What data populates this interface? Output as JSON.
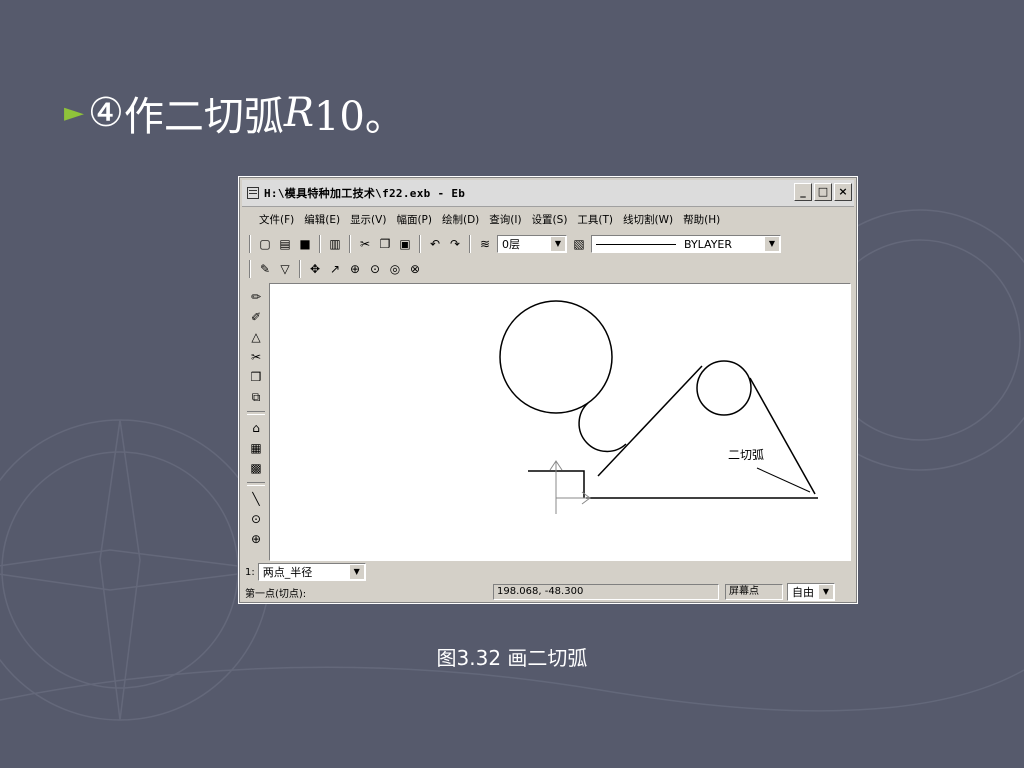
{
  "slide": {
    "bullet_symbol": "►",
    "step_number": "④",
    "heading_text": "作二切弧",
    "heading_italic": "R",
    "heading_tail": "10。",
    "caption": "图3.32  画二切弧"
  },
  "window": {
    "title": "H:\\模具特种加工技术\\f22.exb - Eb",
    "controls": [
      "_",
      "□",
      "×"
    ],
    "menu": [
      "文件(F)",
      "编辑(E)",
      "显示(V)",
      "幅面(P)",
      "绘制(D)",
      "查询(I)",
      "设置(S)",
      "工具(T)",
      "线切割(W)",
      "帮助(H)"
    ],
    "layer_value": "0层",
    "linetype_value": "BYLAYER",
    "drawing_label": "二切弧",
    "command_prefix": "1:",
    "command_mode": "两点_半径",
    "prompt": "第一点(切点):",
    "coordinates": "198.068, -48.300",
    "snap_label": "屏幕点",
    "snap_mode": "自由"
  },
  "icons": {
    "toolbar1": [
      "new-icon",
      "open-icon",
      "save-icon",
      "print-icon",
      "cut-icon",
      "copy-icon",
      "paste-icon",
      "undo-icon",
      "redo-icon",
      "layer-icon"
    ],
    "toolbar2": [
      "pencil-icon",
      "filter-icon",
      "pan-icon",
      "zoom-dynamic-icon",
      "zoom-in-icon",
      "zoom-window-icon",
      "zoom-all-icon",
      "zoom-prev-icon"
    ],
    "left": [
      "draw-icon",
      "edit-icon",
      "dimension-icon",
      "trim-icon",
      "block-icon",
      "library-icon",
      "part-icon",
      "drawing-icon",
      "view-icon",
      "line-icon",
      "circle-add-icon",
      "circle-icon"
    ]
  },
  "colors": {
    "background": "#565a6c",
    "bullet_accent": "#8fc33a",
    "window_face": "#d4d0c8"
  }
}
